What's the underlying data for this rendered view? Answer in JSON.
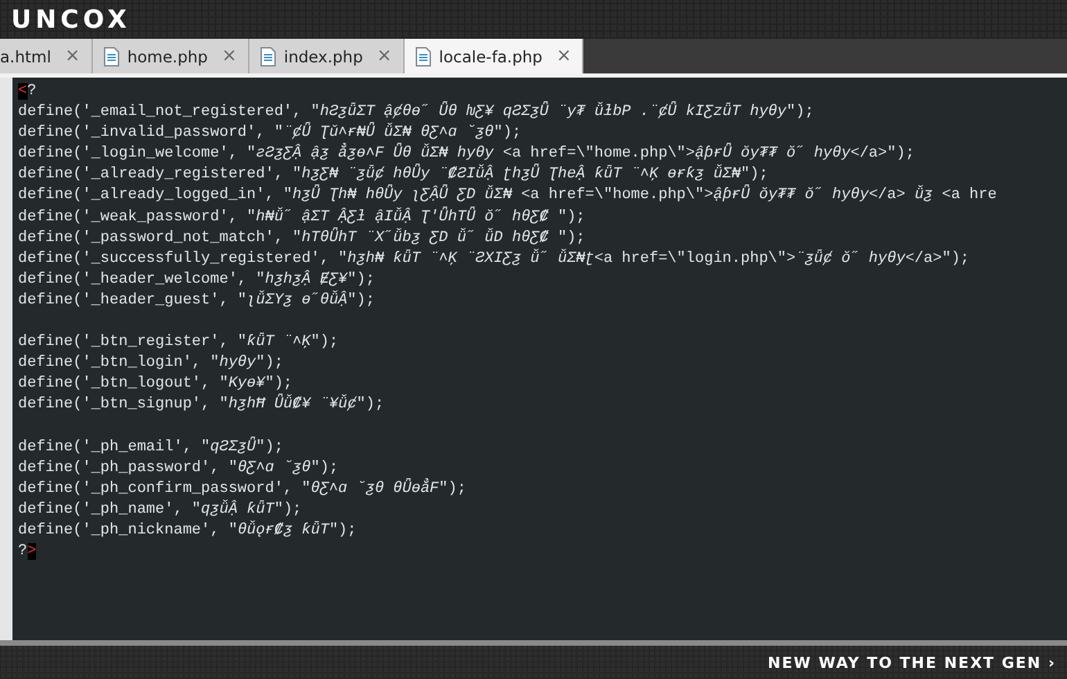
{
  "header": {
    "logo": "UNCOX"
  },
  "tabs": [
    {
      "label": "a.html",
      "close": "×",
      "icon": false,
      "selected": false
    },
    {
      "label": "home.php",
      "close": "×",
      "icon": true,
      "selected": false
    },
    {
      "label": "index.php",
      "close": "×",
      "icon": true,
      "selected": false
    },
    {
      "label": "locale-fa.php",
      "close": "×",
      "icon": true,
      "selected": true
    }
  ],
  "editor": {
    "lines": [
      {
        "kind": "tag",
        "marked": "<",
        "after": "?"
      },
      {
        "kind": "code",
        "text": "define('_email_not_registered', \"*hƧƺǖƩT ậȼθɵ˝ Ǖθ ƕƸ¥ qƧƩƺǕ ¨y₮ ǚɫbP .¨ȼǕ kIƸzǖT hyθy*\");"
      },
      {
        "kind": "code",
        "text": "define('_invalid_password', \"*¨ȼǕ Ʈǔ˄ɍ₦Ǖ ǚƩ₦ θƸ˄ɑ ˘ƺθ*\");"
      },
      {
        "kind": "code",
        "text": "define('_login_welcome', \"*ƨƧƺƸẬ ậƺ ẳƺɵ˄F Ǖθ ǚƩ₦ hyθy* <a href=\\\"home.php\\\">*ậƥɍǕ ŏy₮₮ ŏ˝ hyθy*</a>\");"
      },
      {
        "kind": "code",
        "text": "define('_already_registered', \"*hƺƸ₦ ¨ƺǖȼ hθǕy ¨₡ƧIǚẬ ʈhƺǕ ƮheẬ ƙǖT ¨˄Ķ ɵɍƙƺ ǚƩ₦*\");"
      },
      {
        "kind": "code",
        "text": "define('_already_logged_in', \"*hƺǕ Ʈh₦ hθǕy ʅƸẬǕ ƸD ǚƩ₦* <a href=\\\"home.php\\\">*ậƥɍǕ ŏy₮₮ ŏ˝ hyθy*</a> *ǚƺ* <a hre"
      },
      {
        "kind": "code",
        "text": "define('_weak_password', \"*h₦ǚ˝ ậƩT ẬƸƚ ậIǚẬ Ʈ'ǕhTǕ ŏ˝ hθƸ₡* \");"
      },
      {
        "kind": "code",
        "text": "define('_password_not_match', \"*hTθǕhT ¨X˝ǚbƺ ƸD ǚ˝ ǚD hθƸ₡* \");"
      },
      {
        "kind": "code",
        "text": "define('_successfully_registered', \"*hƺh₦ ƙǖT ¨˄Ķ ¨ƧXIƸƺ ǚ˝ ǚƩ₦ʈ*<a href=\\\"login.php\\\">*¨ƺǖȼ ŏ˝ hyθy*</a>\");"
      },
      {
        "kind": "code",
        "text": "define('_header_welcome', \"*hƺhƺẬ ɆƸ¥*\");"
      },
      {
        "kind": "code",
        "text": "define('_header_guest', \"*ʅǚƩYƺ ɵ˝θǚẬ*\");"
      },
      {
        "kind": "blank"
      },
      {
        "kind": "code",
        "text": "define('_btn_register', \"*ƙǖT ¨˄Ķ*\");"
      },
      {
        "kind": "code",
        "text": "define('_btn_login', \"*hyθy*\");"
      },
      {
        "kind": "code",
        "text": "define('_btn_logout', \"*Kyɵ¥*\");"
      },
      {
        "kind": "code",
        "text": "define('_btn_signup', \"*hƺhĦ Ǖǚ₡¥ ¨¥ǚȼ*\");"
      },
      {
        "kind": "blank"
      },
      {
        "kind": "code",
        "text": "define('_ph_email', \"*qƧƩƺǕ*\");"
      },
      {
        "kind": "code",
        "text": "define('_ph_password', \"*θƸ˄ɑ ˘ƺθ*\");"
      },
      {
        "kind": "code",
        "text": "define('_ph_confirm_password', \"*θƸ˄ɑ ˘ƺθ θǕɵẳF*\");"
      },
      {
        "kind": "code",
        "text": "define('_ph_name', \"*qƺǚẬ ƙǖT*\");"
      },
      {
        "kind": "code",
        "text": "define('_ph_nickname', \"*θǚǫɍ₡ƺ ƙǖT*\");"
      },
      {
        "kind": "tag",
        "before": "?",
        "marked": ">"
      }
    ]
  },
  "footer": {
    "tagline": "NEW WAY TO THE NEXT GEN",
    "arrow": "›"
  }
}
